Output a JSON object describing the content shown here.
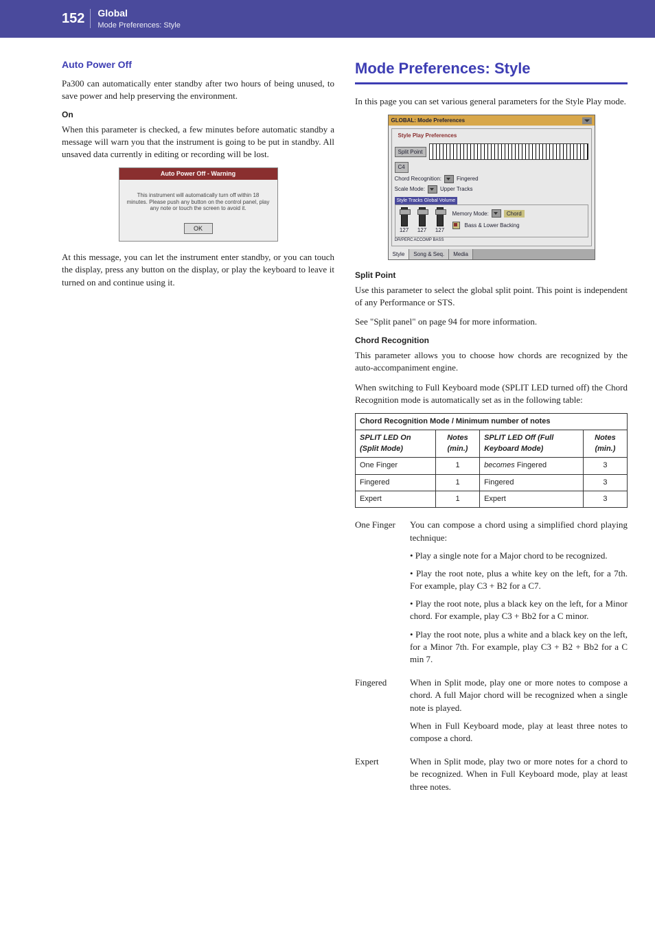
{
  "header": {
    "page_num": "152",
    "title": "Global",
    "subtitle": "Mode Preferences: Style"
  },
  "left": {
    "h": "Auto Power Off",
    "p1": "Pa300 can automatically enter standby after two hours of being unused, to save power and help preserving the environment.",
    "on": "On",
    "p2": "When this parameter is checked, a few minutes before automatic standby a message will warn you that the instrument is going to be put in standby. All unsaved data currently in editing or recording will be lost.",
    "warn_title": "Auto Power Off - Warning",
    "warn_body": "This instrument will automatically turn off within 18 minutes. Please push any button on the control panel, play any note or touch the screen to avoid it.",
    "warn_ok": "OK",
    "p3": "At this message, you can let the instrument enter standby, or you can touch the display, press any button on the display, or play the keyboard to leave it turned on and continue using it."
  },
  "right": {
    "h": "Mode Preferences: Style",
    "intro": "In this page you can set various general parameters for the Style Play mode.",
    "ui": {
      "title": "GLOBAL: Mode Preferences",
      "group1": "Style Play Preferences",
      "split_btn": "Split Point",
      "split_val": "C4",
      "chord_rec_label": "Chord Recognition:",
      "chord_rec_val": "Fingered",
      "scale_label": "Scale Mode:",
      "scale_val": "Upper Tracks",
      "subgroup": "Style Tracks Global Volume",
      "mem_label": "Memory Mode:",
      "mem_val": "Chord",
      "bass_label": "Bass & Lower Backing",
      "slider1": "127",
      "slider2": "127",
      "slider3": "127",
      "slabel1": "DR/PERC",
      "slabel2": "ACCOMP",
      "slabel3": "BASS",
      "tab1": "Style",
      "tab2": "Song & Seq.",
      "tab3": "Media"
    },
    "split_h": "Split Point",
    "split_p1": "Use this parameter to select the global split point. This point is independent of any Performance or STS.",
    "split_p2": "See \"Split panel\" on page 94 for more information.",
    "chord_h": "Chord Recognition",
    "chord_p1": "This parameter allows you to choose how chords are recognized by the auto-accompaniment engine.",
    "chord_p2": "When switching to Full Keyboard mode (SPLIT LED turned off) the Chord Recognition mode is automatically set as in the following table:",
    "table": {
      "caption": "Chord Recognition Mode / Minimum number of notes",
      "col1": "SPLIT LED On (Split Mode)",
      "col2": "Notes (min.)",
      "col3": "SPLIT LED Off (Full Keyboard Mode)",
      "col4": "Notes (min.)",
      "r1c1": "One Finger",
      "r1c2": "1",
      "r1c3_i": "becomes",
      "r1c3": " Fingered",
      "r1c4": "3",
      "r2c1": "Fingered",
      "r2c2": "1",
      "r2c3": "Fingered",
      "r2c4": "3",
      "r3c1": "Expert",
      "r3c2": "1",
      "r3c3": "Expert",
      "r3c4": "3"
    },
    "defs": {
      "t1": "One Finger",
      "d1a": "You can compose a chord using a simplified chord playing technique:",
      "d1b": "• Play a single note for a Major chord to be recognized.",
      "d1c": "• Play the root note, plus a white key on the left, for a 7th. For example, play C3 + B2 for a C7.",
      "d1d": "• Play the root note, plus a black key on the left, for a Minor chord. For example, play C3 + Bb2 for a C minor.",
      "d1e": "• Play the root note, plus a white and a black key on the left, for a Minor 7th. For example, play C3 + B2 + Bb2 for a C min 7.",
      "t2": "Fingered",
      "d2a": "When in Split mode, play one or more notes to compose a chord. A full Major chord will be recognized when a single note is played.",
      "d2b": "When in Full Keyboard mode, play at least three notes to compose a chord.",
      "t3": "Expert",
      "d3a": "When in Split mode, play two or more notes for a chord to be recognized. When in Full Keyboard mode, play at least three notes."
    }
  }
}
